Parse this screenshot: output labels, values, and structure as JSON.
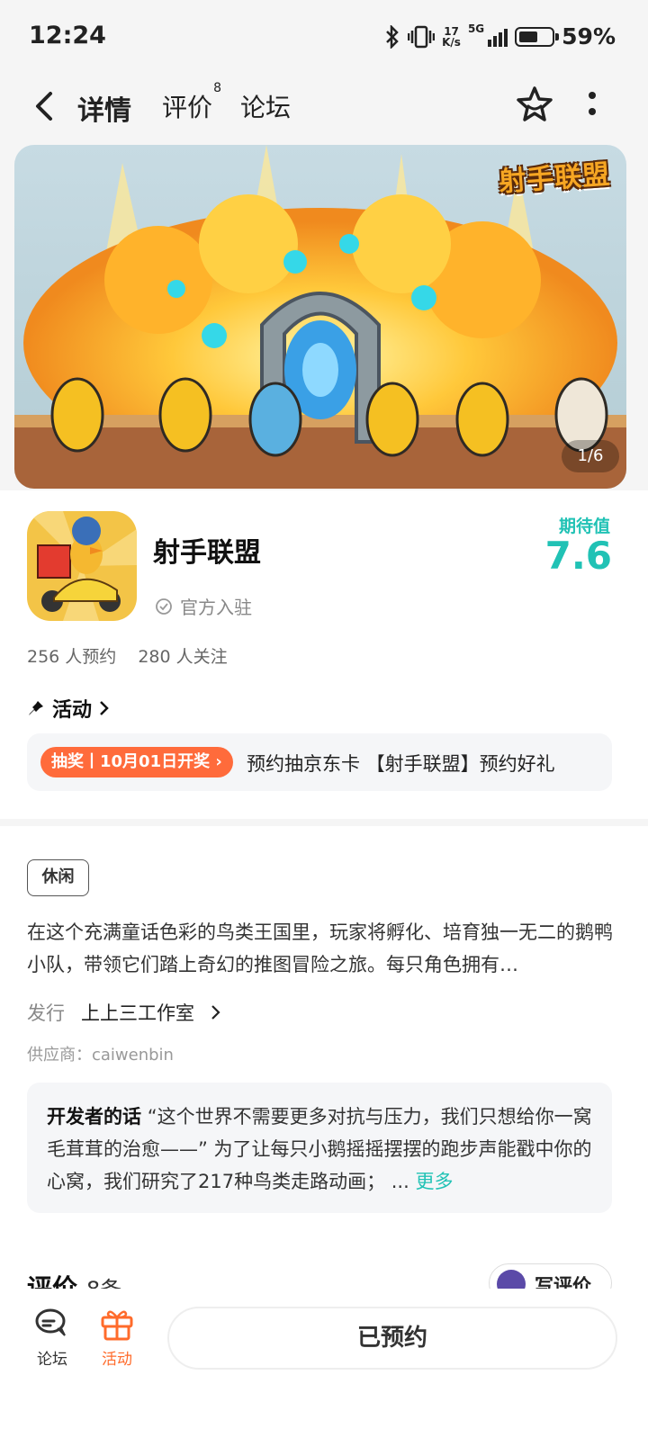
{
  "status_bar": {
    "time": "12:24",
    "net_speed_value": "17",
    "net_speed_unit": "K/s",
    "network": "5G",
    "battery": "59%",
    "battery_level": 0.59
  },
  "nav": {
    "tabs": [
      {
        "label": "详情"
      },
      {
        "label": "评价"
      },
      {
        "label": "论坛"
      }
    ],
    "reviews_badge": "8"
  },
  "banner": {
    "logo_text": "射手联盟",
    "counter": "1/6"
  },
  "game": {
    "name": "射手联盟",
    "official": "官方入驻",
    "expectation_label": "期待值",
    "expectation_value": "7.6",
    "reservations": "256 人预约",
    "followers": "280 人关注"
  },
  "activity": {
    "title": "活动",
    "tag": "抽奖丨10月01日开奖",
    "text": "预约抽京东卡 【射手联盟】预约好礼"
  },
  "info": {
    "genre": "休闲",
    "description": "在这个充满童话色彩的鸟类王国里，玩家将孵化、培育独一无二的鹅鸭小队，带领它们踏上奇幻的推图冒险之旅。每只角色拥有…",
    "publisher_label": "发行",
    "publisher_name": "上上三工作室",
    "supplier": "供应商：caiwenbin"
  },
  "developer": {
    "title": "开发者的话",
    "text": "“这个世界不需要更多对抗与压力，我们只想给你一窝毛茸茸的治愈——” 为了让每只小鹅摇摇摆摆的跑步声能戳中你的心窝，我们研究了217种鸟类走路动画； ...",
    "more": "更多"
  },
  "reviews": {
    "title": "评价",
    "count": "8条",
    "write_label": "写评价"
  },
  "bottom_bar": {
    "forum_label": "论坛",
    "activity_label": "活动",
    "reserve_button": "已预约"
  },
  "colors": {
    "accent": "#21c2b5",
    "highlight": "#21d3c3",
    "activity_tag": "#ff6b3b",
    "bottom_active": "#ff6b2b"
  }
}
